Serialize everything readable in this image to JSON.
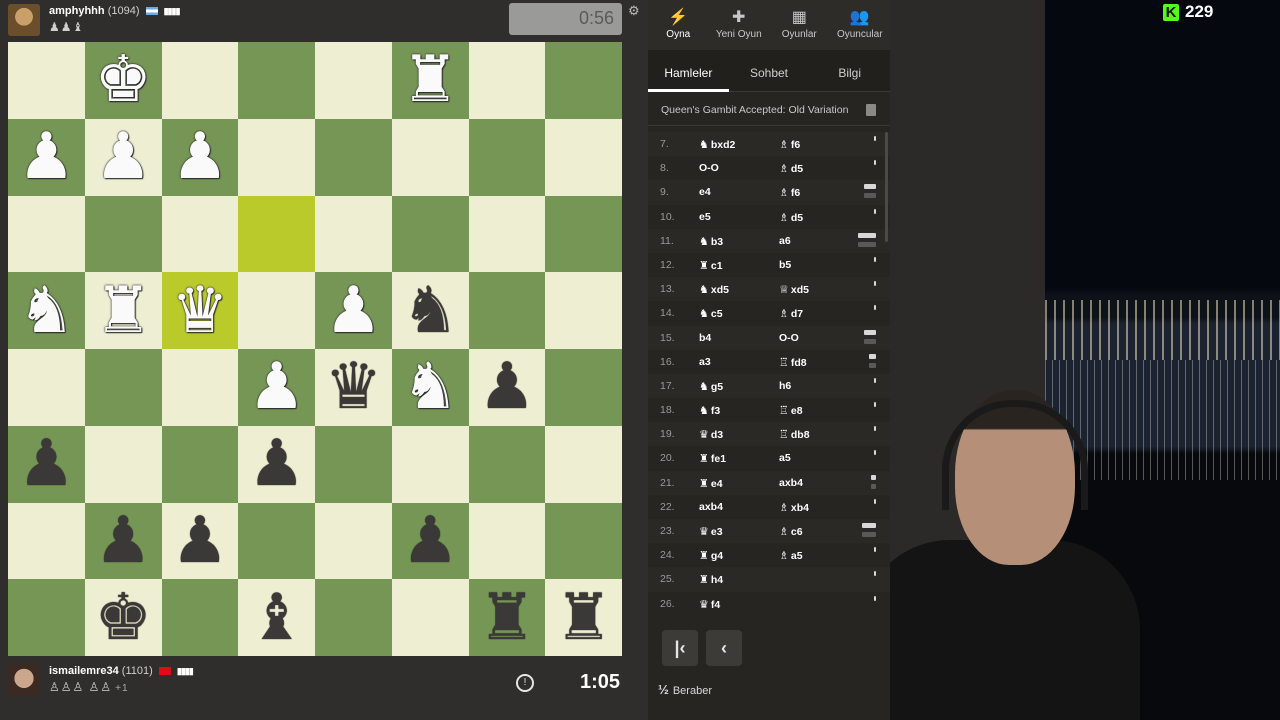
{
  "top_player": {
    "name": "amphyhhh",
    "rating": "(1094)",
    "captured": "♟♟♝",
    "clock": "0:56"
  },
  "bottom_player": {
    "name": "ismailemre34",
    "rating": "(1101)",
    "captured": "♙♙♙ ♙♙",
    "captured_plus": "+1",
    "clock": "1:05"
  },
  "board": {
    "rows": [
      [
        "",
        "wK",
        "",
        "",
        "",
        "wR",
        "",
        ""
      ],
      [
        "wP",
        "wP",
        "wP",
        "",
        "",
        "",
        "",
        ""
      ],
      [
        "",
        "",
        "",
        "",
        "",
        "",
        "",
        ""
      ],
      [
        "wN",
        "wR",
        "wQ",
        "",
        "wP",
        "bN",
        "",
        ""
      ],
      [
        "",
        "",
        "",
        "wP",
        "bQ",
        "wN",
        "bP",
        ""
      ],
      [
        "bP",
        "",
        "",
        "bP",
        "",
        "",
        "",
        ""
      ],
      [
        "",
        "bP",
        "bP",
        "",
        "",
        "bP",
        "",
        ""
      ],
      [
        "",
        "bK",
        "",
        "bB",
        "",
        "",
        "bR",
        "bR"
      ]
    ],
    "highlights": [
      "2-3",
      "3-2"
    ]
  },
  "nav": [
    {
      "label": "Oyna",
      "icon": "⚡"
    },
    {
      "label": "Yeni Oyun",
      "icon": "✚"
    },
    {
      "label": "Oyunlar",
      "icon": "▦"
    },
    {
      "label": "Oyuncular",
      "icon": "👥"
    }
  ],
  "tabs": [
    "Hamleler",
    "Sohbet",
    "Bilgi"
  ],
  "opening": "Queen's Gambit Accepted: Old Variation",
  "moves": [
    {
      "n": "7.",
      "wf": "♞",
      "w": "bxd2",
      "bf": "♗",
      "b": "f6",
      "tw": 0,
      "tb": 0
    },
    {
      "n": "8.",
      "wf": "",
      "w": "O-O",
      "bf": "♗",
      "b": "d5",
      "tw": 0,
      "tb": 0
    },
    {
      "n": "9.",
      "wf": "",
      "w": "e4",
      "bf": "♗",
      "b": "f6",
      "tw": 12,
      "tb": 0
    },
    {
      "n": "10.",
      "wf": "",
      "w": "e5",
      "bf": "♗",
      "b": "d5",
      "tw": 0,
      "tb": 0
    },
    {
      "n": "11.",
      "wf": "♞",
      "w": "b3",
      "bf": "",
      "b": "a6",
      "tw": 18,
      "tb": 0
    },
    {
      "n": "12.",
      "wf": "♜",
      "w": "c1",
      "bf": "",
      "b": "b5",
      "tw": 0,
      "tb": 0
    },
    {
      "n": "13.",
      "wf": "♞",
      "w": "xd5",
      "bf": "♕",
      "b": "xd5",
      "tw": 0,
      "tb": 0
    },
    {
      "n": "14.",
      "wf": "♞",
      "w": "c5",
      "bf": "♗",
      "b": "d7",
      "tw": 0,
      "tb": 0
    },
    {
      "n": "15.",
      "wf": "",
      "w": "b4",
      "bf": "",
      "b": "O-O",
      "tw": 12,
      "tb": 0
    },
    {
      "n": "16.",
      "wf": "",
      "w": "a3",
      "bf": "♖",
      "b": "fd8",
      "tw": 7,
      "tb": 0
    },
    {
      "n": "17.",
      "wf": "♞",
      "w": "g5",
      "bf": "",
      "b": "h6",
      "tw": 0,
      "tb": 0
    },
    {
      "n": "18.",
      "wf": "♞",
      "w": "f3",
      "bf": "♖",
      "b": "e8",
      "tw": 0,
      "tb": 0
    },
    {
      "n": "19.",
      "wf": "♛",
      "w": "d3",
      "bf": "♖",
      "b": "db8",
      "tw": 0,
      "tb": 0
    },
    {
      "n": "20.",
      "wf": "♜",
      "w": "fe1",
      "bf": "",
      "b": "a5",
      "tw": 0,
      "tb": 0
    },
    {
      "n": "21.",
      "wf": "♜",
      "w": "e4",
      "bf": "",
      "b": "axb4",
      "tw": 5,
      "tb": 0
    },
    {
      "n": "22.",
      "wf": "",
      "w": "axb4",
      "bf": "♗",
      "b": "xb4",
      "tw": 0,
      "tb": 0
    },
    {
      "n": "23.",
      "wf": "♛",
      "w": "e3",
      "bf": "♗",
      "b": "c6",
      "tw": 14,
      "tb": 0
    },
    {
      "n": "24.",
      "wf": "♜",
      "w": "g4",
      "bf": "♗",
      "b": "a5",
      "tw": 0,
      "tb": 0
    },
    {
      "n": "25.",
      "wf": "♜",
      "w": "h4",
      "bf": "",
      "b": "",
      "tw": 0,
      "tb": 0
    },
    {
      "n": "26.",
      "wf": "♛",
      "w": "f4",
      "bf": "",
      "b": "",
      "tw": 0,
      "tb": 0
    }
  ],
  "controls": {
    "first": "|‹",
    "prev": "‹"
  },
  "draw": {
    "symbol": "½",
    "label": "Beraber"
  },
  "kick": {
    "viewers": "229"
  },
  "colors": {
    "light_square": "#eeeed2",
    "dark_square": "#769656",
    "kick_green": "#53fc18"
  }
}
